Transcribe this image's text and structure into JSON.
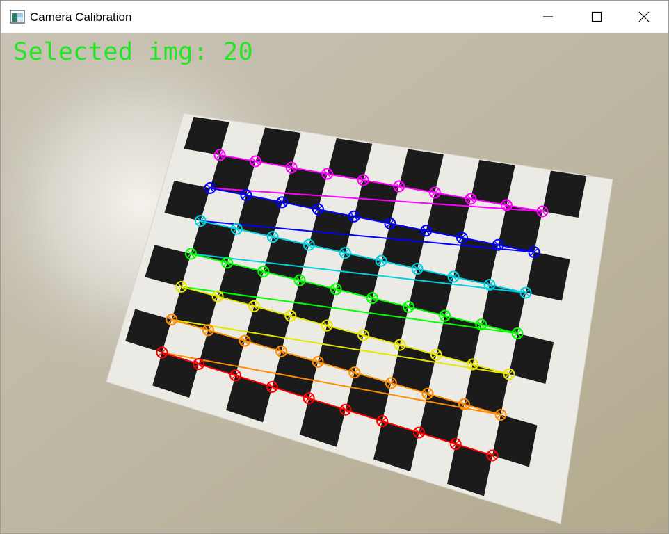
{
  "window": {
    "title": "Camera Calibration",
    "icon": "app-window-icon",
    "buttons": {
      "minimize": "minimize-icon",
      "maximize": "maximize-icon",
      "close": "close-icon"
    }
  },
  "overlay": {
    "text": "Selected img: 20",
    "color": "#22e622"
  },
  "scene": {
    "description_icons": [
      "checkerboard",
      "corner-markers"
    ],
    "row_colors": [
      "#ff00ff",
      "#0000ff",
      "#00d0e0",
      "#00ff00",
      "#e6e600",
      "#ff8c00",
      "#ff0000"
    ]
  }
}
